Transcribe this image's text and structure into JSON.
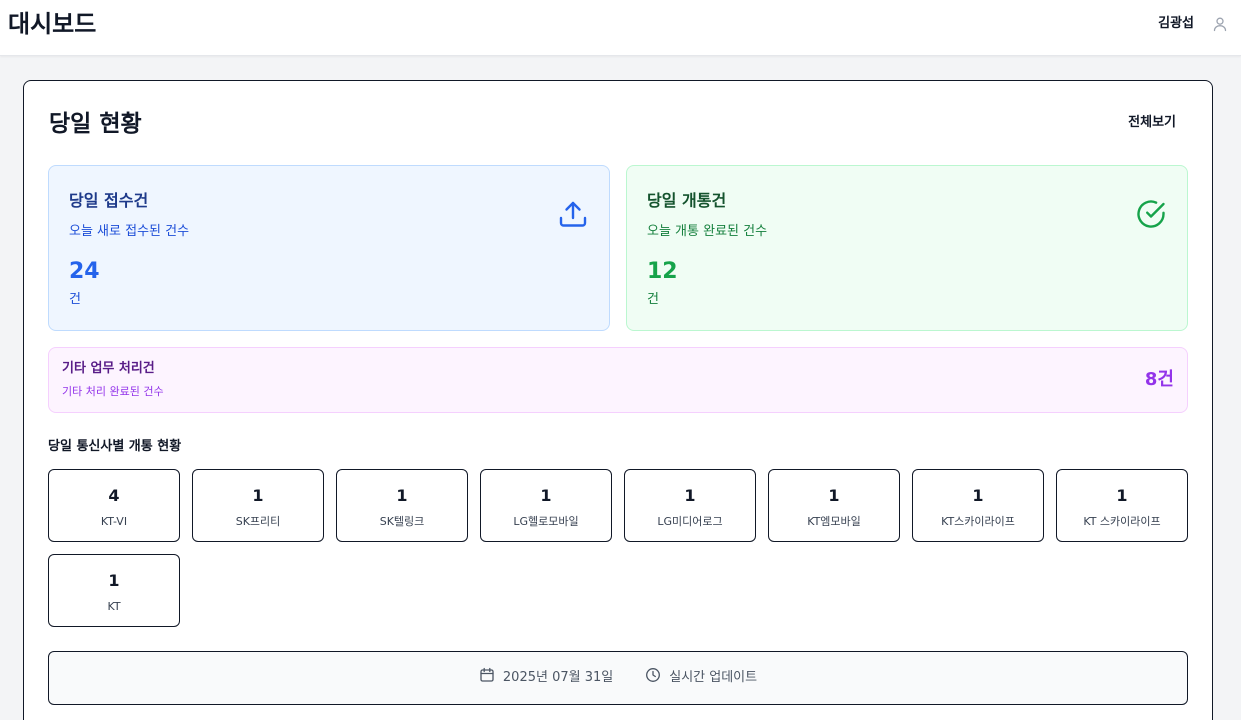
{
  "header": {
    "app_title": "대시보드",
    "user_name": "김광섭"
  },
  "main": {
    "title": "당일 현황",
    "view_all_label": "전체보기",
    "received": {
      "title": "당일 접수건",
      "subtitle": "오늘 새로 접수된 건수",
      "value": "24",
      "unit": "건",
      "icon": "upload-icon",
      "color": "#2563eb"
    },
    "opened": {
      "title": "당일 개통건",
      "subtitle": "오늘 개통 완료된 건수",
      "value": "12",
      "unit": "건",
      "icon": "check-circle-icon",
      "color": "#16a34a"
    },
    "other": {
      "title": "기타 업무 처리건",
      "subtitle": "기타 처리 완료된 건수",
      "value": "8건",
      "color": "#9333ea"
    },
    "carrier_section_title": "당일 통신사별 개통 현황",
    "carriers": [
      {
        "count": "4",
        "name": "KT-VI"
      },
      {
        "count": "1",
        "name": "SK프리티"
      },
      {
        "count": "1",
        "name": "SK텔링크"
      },
      {
        "count": "1",
        "name": "LG헬로모바일"
      },
      {
        "count": "1",
        "name": "LG미디어로그"
      },
      {
        "count": "1",
        "name": "KT엠모바일"
      },
      {
        "count": "1",
        "name": "KT스카이라이프"
      },
      {
        "count": "1",
        "name": "KT 스카이라이프"
      },
      {
        "count": "1",
        "name": "KT"
      }
    ],
    "footer": {
      "date": "2025년 07월 31일",
      "date_icon": "calendar-icon",
      "update_label": "실시간 업데이트",
      "update_icon": "clock-icon"
    }
  }
}
